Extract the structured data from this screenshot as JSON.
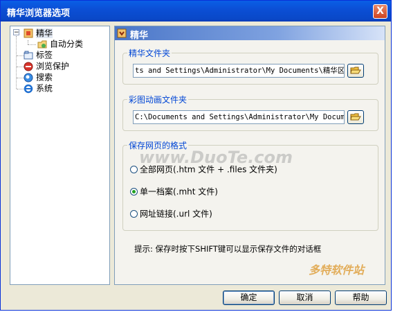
{
  "window": {
    "title": "精华浏览器选项",
    "close_label": "X"
  },
  "tree": {
    "items": [
      {
        "label": "精华",
        "icon": "favorites-folder-icon"
      },
      {
        "label": "自动分类",
        "icon": "auto-classify-icon"
      },
      {
        "label": "标签",
        "icon": "tabs-icon"
      },
      {
        "label": "浏览保护",
        "icon": "protection-icon"
      },
      {
        "label": "搜索",
        "icon": "search-icon"
      },
      {
        "label": "系统",
        "icon": "system-ie-icon"
      }
    ],
    "expander": "−"
  },
  "panel": {
    "header": "精华",
    "favorites_group": {
      "legend": "精华文件夹",
      "path": "ts and Settings\\Administrator\\My Documents\\精华区\\"
    },
    "animation_group": {
      "legend": "彩图动画文件夹",
      "path": "C:\\Documents and Settings\\Administrator\\My Documen"
    },
    "format_group": {
      "legend": "保存网页的格式",
      "options": [
        {
          "label": "全部网页(.htm 文件 + .files 文件夹)",
          "checked": false
        },
        {
          "label": "单一档案(.mht 文件)",
          "checked": true
        },
        {
          "label": "网址链接(.url 文件)",
          "checked": false
        }
      ]
    },
    "tip": "提示: 保存时按下SHIFT键可以显示保存文件的对话框"
  },
  "buttons": {
    "ok": "确定",
    "cancel": "取消",
    "help": "帮助"
  },
  "watermarks": {
    "main": "www.DuoTe.com",
    "corner": "多特软件站"
  },
  "colors": {
    "title_bar": "#0a5fe6",
    "legend_text": "#0046d5",
    "radio_checked": "#21a121"
  }
}
